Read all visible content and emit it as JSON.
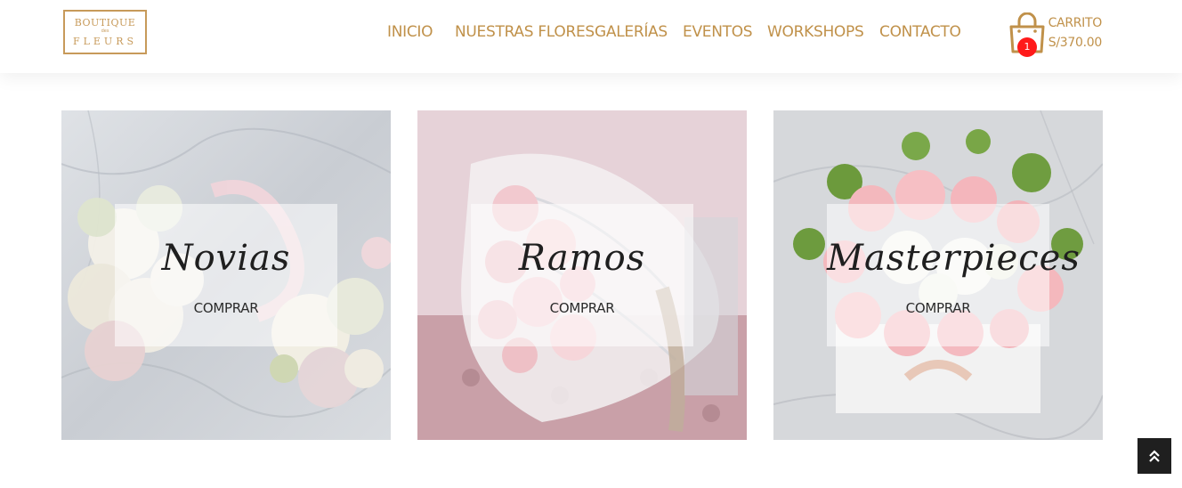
{
  "brand": {
    "logo_line1": "BOUTIQUE",
    "logo_line2": "des",
    "logo_line3": "FLEURS"
  },
  "nav": {
    "items": [
      {
        "label": "INICIO"
      },
      {
        "label": "NUESTRAS FLORES"
      },
      {
        "label": "GALERÍAS"
      },
      {
        "label": "EVENTOS"
      },
      {
        "label": "WORKSHOPS"
      },
      {
        "label": "CONTACTO"
      }
    ]
  },
  "cart": {
    "icon": "shopping-bag-icon",
    "count": "1",
    "label": "CARRITO",
    "total": "S/370.00"
  },
  "cards": [
    {
      "title": "Novias",
      "cta": "COMPRAR",
      "image": "bridal-bouquet-on-marble"
    },
    {
      "title": "Ramos",
      "cta": "COMPRAR",
      "image": "pink-rose-bouquet-on-velvet"
    },
    {
      "title": "Masterpieces",
      "cta": "COMPRAR",
      "image": "pink-roses-box-arrangement"
    }
  ],
  "scroll_top": {
    "icon": "double-chevron-up-icon"
  },
  "colors": {
    "gold": "#c0914a",
    "badge": "#ff1a1a",
    "dark": "#1f1f1f"
  }
}
